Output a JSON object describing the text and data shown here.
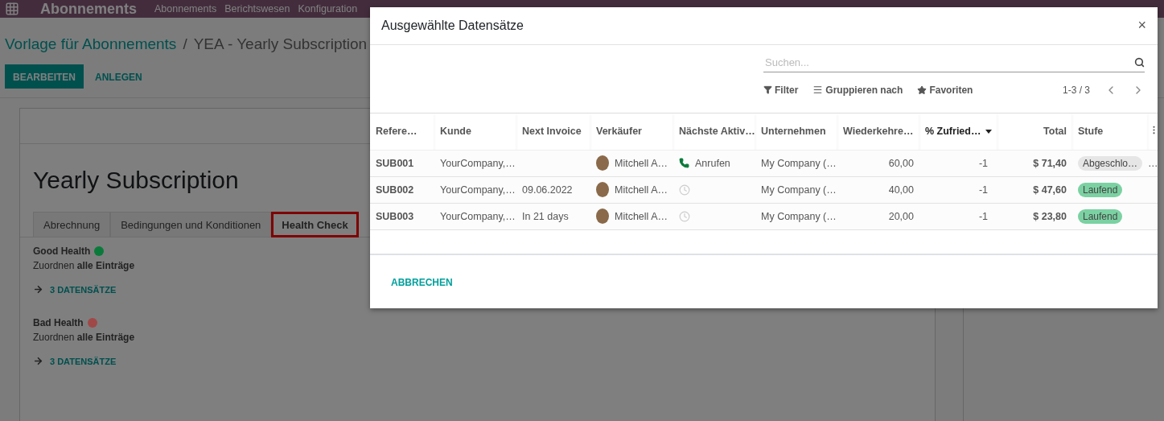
{
  "app": {
    "title": "Abonnements",
    "menu": [
      {
        "label": "Abonnements"
      },
      {
        "label": "Berichtswesen"
      },
      {
        "label": "Konfiguration"
      }
    ]
  },
  "breadcrumb": {
    "parent": "Vorlage für Abonnements",
    "separator": "/",
    "current": "YEA - Yearly Subscription"
  },
  "actions": [
    {
      "label": "BEARBEITEN",
      "kind": "primary"
    },
    {
      "label": "ANLEGEN",
      "kind": "secondary"
    }
  ],
  "record": {
    "title": "Yearly Subscription",
    "tabs": [
      {
        "label": "Abrechnung",
        "selected": false,
        "highlighted": false
      },
      {
        "label": "Bedingungen und Konditionen",
        "selected": false,
        "highlighted": false
      },
      {
        "label": "Health Check",
        "selected": true,
        "highlighted": true
      }
    ],
    "health": [
      {
        "name": "Good Health",
        "color": "#0a7a3a",
        "rule": "Zuordnen **alle Einträge**",
        "link": "3 DATENSÄTZE"
      },
      {
        "name": "Bad Health",
        "color": "#a04848",
        "rule": "Zuordnen **alle Einträge**",
        "link": "3 DATENSÄTZE"
      }
    ]
  },
  "dialog": {
    "title": "Ausgewählte Datensätze",
    "close": "×",
    "search": {
      "placeholder": "Suchen..."
    },
    "filters": [
      {
        "kind": "filter",
        "label": "Filter"
      },
      {
        "kind": "group",
        "label": "Gruppieren nach"
      },
      {
        "kind": "favorites",
        "label": "Favoriten"
      }
    ],
    "pager": "1-3 / 3",
    "columns": [
      {
        "label": "Refere…",
        "sorted": false
      },
      {
        "label": "Kunde",
        "sorted": false
      },
      {
        "label": "Next Invoice",
        "sorted": false
      },
      {
        "label": "Verkäufer",
        "sorted": false
      },
      {
        "label": "Nächste Aktiv…",
        "sorted": false
      },
      {
        "label": "Unternehmen",
        "sorted": false
      },
      {
        "label": "Wiederkehre…",
        "sorted": false
      },
      {
        "label": "% Zufried…",
        "sorted": true
      },
      {
        "label": "Total",
        "sorted": false
      },
      {
        "label": "Stufe",
        "sorted": false
      }
    ],
    "rows": [
      {
        "reference": "SUB001",
        "customer": "YourCompany,…",
        "salesperson": "Mitchell A…",
        "activity": {
          "kind": "call",
          "label": "Anrufen"
        },
        "company": "My Company (…",
        "recurring": "60,00",
        "satisfaction": "-1",
        "total": "$ 71,40",
        "stage": {
          "label": "Abgeschlo…",
          "color": "#e6e6e6"
        },
        "overflow": "…"
      },
      {
        "reference": "SUB002",
        "customer": "YourCompany,…",
        "next_invoice": "09.06.2022",
        "salesperson": "Mitchell A…",
        "activity": {
          "kind": "none"
        },
        "company": "My Company (…",
        "recurring": "40,00",
        "satisfaction": "-1",
        "total": "$ 47,60",
        "stage": {
          "label": "Laufend",
          "color": "#7bd1a2"
        }
      },
      {
        "reference": "SUB003",
        "customer": "YourCompany,…",
        "next_invoice": "In 21 days",
        "salesperson": "Mitchell A…",
        "activity": {
          "kind": "none"
        },
        "company": "My Company (…",
        "recurring": "20,00",
        "satisfaction": "-1",
        "total": "$ 23,80",
        "stage": {
          "label": "Laufend",
          "color": "#7bd1a2"
        }
      }
    ],
    "cancel": "ABBRECHEN"
  }
}
